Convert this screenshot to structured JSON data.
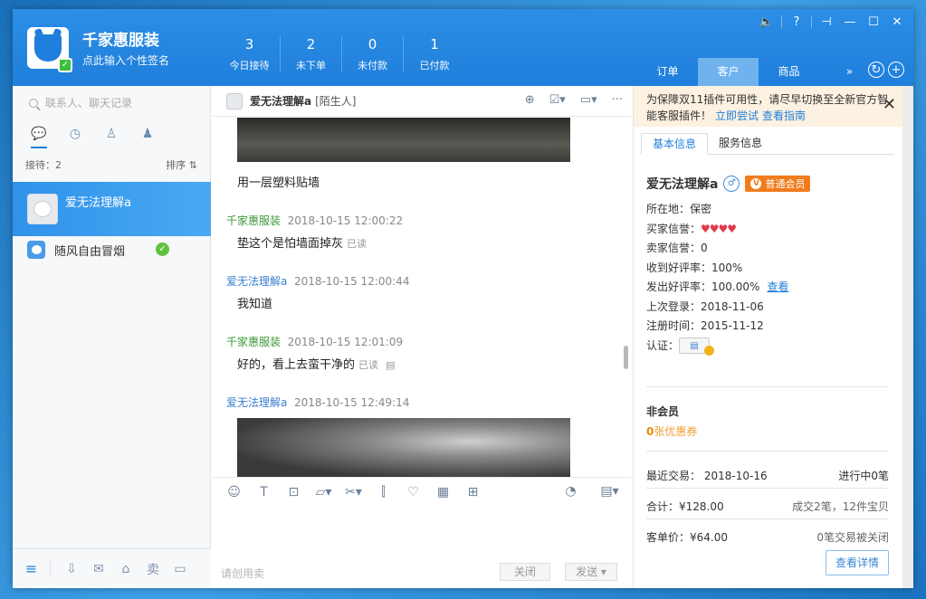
{
  "header": {
    "shop_name": "千家惠服装",
    "signature_placeholder": "点此输入个性签名",
    "stats": [
      {
        "num": "3",
        "label": "今日接待"
      },
      {
        "num": "2",
        "label": "未下单"
      },
      {
        "num": "0",
        "label": "未付款"
      },
      {
        "num": "1",
        "label": "已付款"
      }
    ],
    "tabs": [
      {
        "label": "订单"
      },
      {
        "label": "客户"
      },
      {
        "label": "商品"
      },
      {
        "label": "»"
      }
    ],
    "active_tab": "客户"
  },
  "left": {
    "search_placeholder": "联系人、聊天记录",
    "reception_label": "接待：2",
    "sort_label": "排序 ⇅",
    "contacts": [
      {
        "name": "爱无法理解a"
      },
      {
        "name": "随风自由冒烟"
      }
    ]
  },
  "chat": {
    "title": "爱无法理解a",
    "tag": "[陌生人]",
    "messages": [
      {
        "text": "用一层塑料贴墙"
      },
      {
        "sender": "千家惠服装",
        "time": "2018-10-15 12:00:22",
        "text": "垫这个是怕墙面掉灰",
        "read": "已读"
      },
      {
        "sender": "爱无法理解a",
        "time": "2018-10-15 12:00:44",
        "text": "我知道"
      },
      {
        "sender": "千家惠服装",
        "time": "2018-10-15 12:01:09",
        "text": "好的，看上去蛮干净的",
        "read": "已读"
      },
      {
        "sender": "爱无法理解a",
        "time": "2018-10-15 12:49:14"
      }
    ],
    "input_hint": "请创用卖",
    "close_label": "关闭",
    "send_label": "发送 ▾"
  },
  "right": {
    "notice_text": "为保障双11插件可用性，请尽早切换至全新官方智能客服插件！",
    "notice_link1": "立即尝试",
    "notice_link2": "查看指南",
    "tabs": [
      {
        "label": "基本信息"
      },
      {
        "label": "服务信息"
      }
    ],
    "buyer_name": "爱无法理解a",
    "member_label": "普通会员",
    "location": "所在地：保密",
    "buyer_credit_label": "买家信誉：",
    "buyer_credit_hearts": "♥♥♥♥",
    "seller_credit": "卖家信誉：0",
    "recv_rate": "收到好评率：100%",
    "send_rate": "发出好评率：100.00%",
    "view_label": "查看",
    "last_login": "上次登录：2018-11-06",
    "register_time": "注册时间：2015-11-12",
    "cert_label": "认证：",
    "non_member": "非会员",
    "coupon_count": "0",
    "coupon_suffix": "张优惠券",
    "recent_trade_label": "最近交易：",
    "recent_trade_date": "2018-10-16",
    "in_progress": "进行中0笔",
    "total": "合计：¥128.00",
    "deals": "成交2笔，12件宝贝",
    "avg_price": "客单价：¥64.00",
    "closed": "0笔交易被关闭",
    "detail_btn": "查看详情"
  },
  "colors": {
    "accent": "#1f7fdc",
    "seller_name": "#3a9a3a",
    "buyer_name": "#3a7fd0",
    "member_badge": "#f07c1c"
  }
}
